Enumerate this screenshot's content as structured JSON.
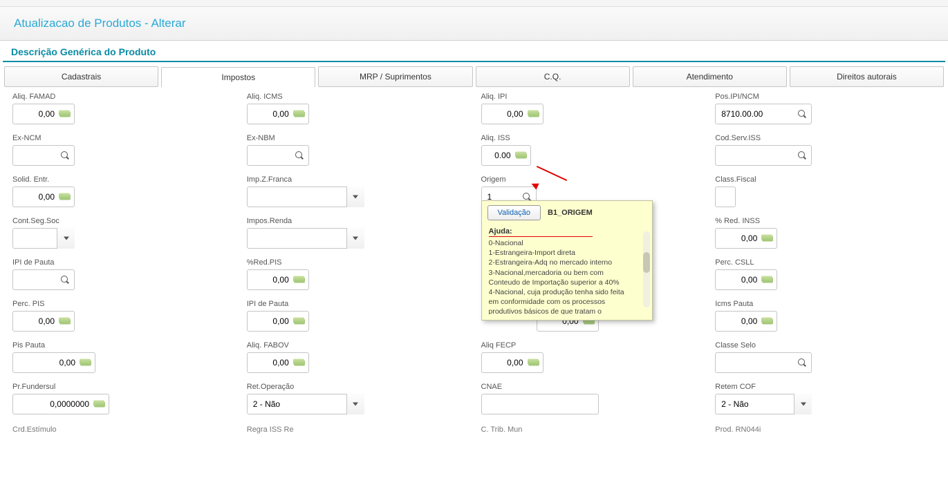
{
  "header": {
    "title": "Atualizacao de Produtos - Alterar",
    "subtitle": "Descrição Genérica do Produto"
  },
  "tabs": [
    "Cadastrais",
    "Impostos",
    "MRP / Suprimentos",
    "C.Q.",
    "Atendimento",
    "Direitos autorais"
  ],
  "active_tab_index": 1,
  "fields": {
    "aliq_famad": {
      "label": "Aliq. FAMAD",
      "value": "0,00"
    },
    "aliq_icms": {
      "label": "Aliq. ICMS",
      "value": "0,00"
    },
    "aliq_ipi": {
      "label": "Aliq. IPI",
      "value": "0,00"
    },
    "pos_ipi_ncm": {
      "label": "Pos.IPI/NCM",
      "value": "8710.00.00"
    },
    "ex_ncm": {
      "label": "Ex-NCM",
      "value": ""
    },
    "ex_nbm": {
      "label": "Ex-NBM",
      "value": ""
    },
    "aliq_iss": {
      "label": "Aliq. ISS",
      "value": "0.00"
    },
    "cod_serv_iss": {
      "label": "Cod.Serv.ISS",
      "value": ""
    },
    "solid_entr": {
      "label": "Solid. Entr.",
      "value": "0,00"
    },
    "imp_z_franca": {
      "label": "Imp.Z.Franca",
      "value": ""
    },
    "origem": {
      "label": "Origem",
      "value": "1"
    },
    "class_fiscal": {
      "label": "Class.Fiscal",
      "value": ""
    },
    "cont_seg_soc": {
      "label": "Cont.Seg.Soc",
      "value": ""
    },
    "impos_renda": {
      "label": "Impos.Renda",
      "value": ""
    },
    "pct_red_inss": {
      "label": "% Red. INSS",
      "value": "0,00"
    },
    "ipi_pauta": {
      "label": "IPI de Pauta",
      "value": ""
    },
    "pct_red_pis": {
      "label": "%Red.PIS",
      "value": "0,00"
    },
    "perc_csll": {
      "label": "Perc. CSLL",
      "value": "0,00"
    },
    "perc_pis": {
      "label": "Perc. PIS",
      "value": "0,00"
    },
    "ipi_pauta2": {
      "label": "IPI de Pauta",
      "value": "0,00"
    },
    "hidden_field": {
      "label": "",
      "value": "0,00"
    },
    "icms_pauta": {
      "label": "Icms Pauta",
      "value": "0,00"
    },
    "pis_pauta": {
      "label": "Pis Pauta",
      "value": "0,00"
    },
    "aliq_fabov": {
      "label": "Aliq. FABOV",
      "value": "0,00"
    },
    "aliq_fecp": {
      "label": "Aliq FECP",
      "value": "0,00"
    },
    "classe_selo": {
      "label": "Classe Selo",
      "value": ""
    },
    "pr_fundersul": {
      "label": "Pr.Fundersul",
      "value": "0,0000000"
    },
    "ret_operacao": {
      "label": "Ret.Operação",
      "value": "2 - Não"
    },
    "cnae": {
      "label": "CNAE",
      "value": ""
    },
    "retem_cof": {
      "label": "Retem COF",
      "value": "2 - Não"
    },
    "crd_estimulo": {
      "label": "Crd.Estímulo"
    },
    "regra_iss_re": {
      "label": "Regra ISS Re"
    },
    "c_trib_mun": {
      "label": "C. Trib. Mun"
    },
    "prod_rn044": {
      "label": "Prod. RN044i"
    }
  },
  "popup": {
    "button": "Validação",
    "code": "B1_ORIGEM",
    "help_label": "Ajuda:",
    "lines": [
      "0-Nacional",
      "1-Estrangeira-Import direta",
      "2-Estrangeira-Adq no mercado interno",
      "3-Nacional,mercadoria ou bem com Conteudo de Importação superior a  40%",
      "4-Nacional, cuja produção tenha sido feita em conformidade com os processos produtivos básicos de que tratam o"
    ]
  }
}
